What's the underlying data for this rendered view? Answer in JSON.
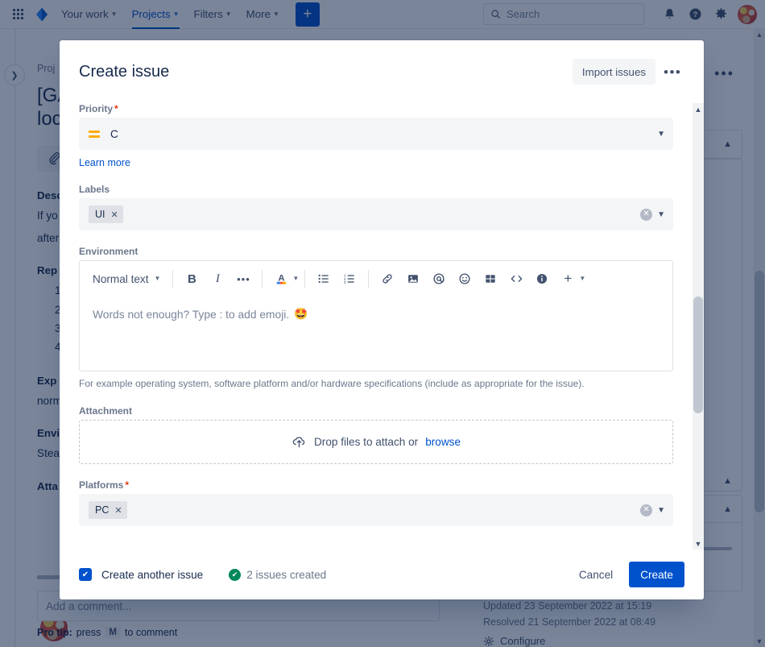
{
  "topnav": {
    "apps_icon": "app-switcher-icon",
    "logo_icon": "jira-logo-icon",
    "items": [
      {
        "label": "Your work",
        "has_caret": true,
        "active": false
      },
      {
        "label": "Projects",
        "has_caret": true,
        "active": true
      },
      {
        "label": "Filters",
        "has_caret": true,
        "active": false
      },
      {
        "label": "More",
        "has_caret": true,
        "active": false
      }
    ],
    "create_label": "+",
    "search_placeholder": "Search",
    "search_value": "",
    "notifications_icon": "bell-icon",
    "help_icon": "help-icon",
    "settings_icon": "gear-icon",
    "avatar": "user-avatar"
  },
  "background": {
    "breadcrumb": "Proj",
    "issue_title_line1": "[GA",
    "issue_title_line2": "loc",
    "attach_icon": "paperclip-icon",
    "description_heading": "Desc",
    "description_line1": "If yo",
    "description_line2": "after",
    "repro_heading": "Rep",
    "repro_steps": [
      "1.",
      "2.",
      "3.",
      "4."
    ],
    "expected_heading": "Exp",
    "expected_text": "norm",
    "environment_heading": "Envi",
    "environment_text": "Stea",
    "attachments_heading": "Atta",
    "comment_placeholder": "Add a comment...",
    "protip_prefix": "Pro tip:",
    "protip_press": "press",
    "protip_key": "M",
    "protip_suffix": "to comment",
    "updated_text": "Updated 23 September 2022 at 15:19",
    "resolved_text": "Resolved 21 September 2022 at 08:49",
    "configure_label": "Configure",
    "configure_icon": "gear-icon",
    "more_icon": "more-actions-icon"
  },
  "modal": {
    "title": "Create issue",
    "import_label": "Import issues",
    "more_label": "•••",
    "fields": {
      "priority": {
        "label": "Priority",
        "required": true,
        "value": "C",
        "icon": "priority-medium-icon",
        "learn_more": "Learn more"
      },
      "labels": {
        "label": "Labels",
        "required": false,
        "chips": [
          "UI"
        ]
      },
      "environment": {
        "label": "Environment",
        "required": false,
        "toolbar": {
          "style_label": "Normal text",
          "bold": "B",
          "italic": "I",
          "more": "•••",
          "text_color": "A",
          "bullet_list": "bullet-list-icon",
          "numbered_list": "numbered-list-icon",
          "link": "link-icon",
          "image": "image-icon",
          "mention": "@",
          "emoji": "emoji-icon",
          "table": "table-icon",
          "code": "code-icon",
          "info": "info-panel-icon",
          "plus": "+"
        },
        "placeholder": "Words not enough? Type : to add emoji.",
        "placeholder_emoji": "🤩",
        "help": "For example operating system, software platform and/or hardware specifications (include as appropriate for the issue)."
      },
      "attachment": {
        "label": "Attachment",
        "drop_text": "Drop files to attach or",
        "browse_text": "browse",
        "icon": "upload-cloud-icon"
      },
      "platforms": {
        "label": "Platforms",
        "required": true,
        "chips": [
          "PC"
        ]
      }
    },
    "footer": {
      "create_another_label": "Create another issue",
      "create_another_checked": true,
      "status_text": "2 issues created",
      "status_icon": "success-check-icon",
      "cancel_label": "Cancel",
      "create_label": "Create"
    }
  },
  "colors": {
    "brand_blue": "#0052cc",
    "text_dark": "#172b4d",
    "text_subtle": "#6b778c",
    "priority_medium": "#ffab00",
    "success_green": "#00875a",
    "required_red": "#de350b",
    "overlay": "rgba(9,30,66,0.54)"
  }
}
